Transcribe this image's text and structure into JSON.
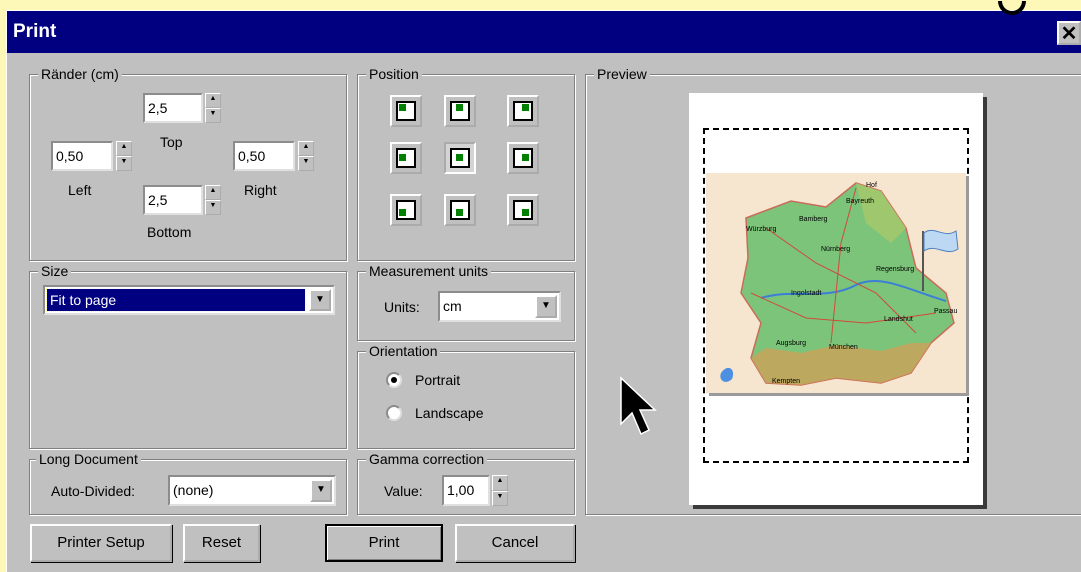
{
  "window": {
    "title": "Print",
    "close_glyph": "✕"
  },
  "margins": {
    "legend": "Ränder (cm)",
    "top": {
      "value": "2,5",
      "label": "Top"
    },
    "left": {
      "value": "0,50",
      "label": "Left"
    },
    "right": {
      "value": "0,50",
      "label": "Right"
    },
    "bottom": {
      "value": "2,5",
      "label": "Bottom"
    }
  },
  "position": {
    "legend": "Position",
    "selected": "middle-center"
  },
  "size": {
    "legend": "Size",
    "selected": "Fit to page"
  },
  "measurement": {
    "legend": "Measurement units",
    "label": "Units:",
    "value": "cm"
  },
  "orientation": {
    "legend": "Orientation",
    "options": [
      "Portrait",
      "Landscape"
    ],
    "selected": "Portrait"
  },
  "long_document": {
    "legend": "Long Document",
    "label": "Auto-Divided:",
    "value": "(none)"
  },
  "gamma": {
    "legend": "Gamma correction",
    "label": "Value:",
    "value": "1,00"
  },
  "preview": {
    "legend": "Preview"
  },
  "map_labels": [
    "Hof",
    "Bayreuth",
    "Würzburg",
    "Bamberg",
    "Nürnberg",
    "Regensburg",
    "Ingolstadt",
    "Passau",
    "Landshut",
    "Augsburg",
    "München",
    "Kempten"
  ],
  "buttons": {
    "printer_setup": "Printer Setup",
    "reset": "Reset",
    "print": "Print",
    "cancel": "Cancel"
  },
  "colors": {
    "titlebar": "#000080",
    "dialog": "#c0c0c0",
    "background": "#fdf7b8",
    "position_marker": "#008000",
    "selection": "#000080"
  }
}
